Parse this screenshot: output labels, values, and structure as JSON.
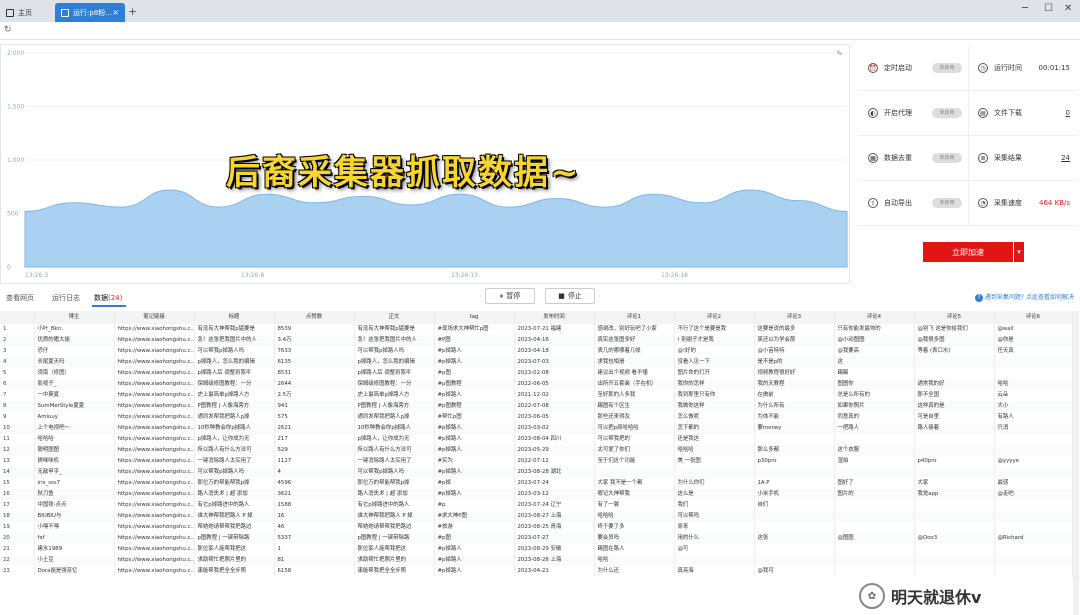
{
  "tabs": {
    "home": "主页",
    "active": "运行:p8粉..."
  },
  "chart": {
    "yticks": [
      "2,000",
      "1,500",
      "1,000",
      "500",
      "0"
    ],
    "xticks": [
      "13:26:3",
      "13:26:8",
      "13:26:13",
      "13:26:18"
    ],
    "overlay": "后裔采集器抓取数据~"
  },
  "chart_data": {
    "type": "area",
    "ylim": [
      0,
      2000
    ],
    "x": [
      "13:26:3",
      "13:26:8",
      "13:26:13",
      "13:26:18"
    ],
    "series": [
      {
        "values": [
          520,
          600,
          560,
          720,
          560,
          680,
          600,
          660,
          580,
          680,
          560,
          640,
          560,
          680,
          600,
          720,
          620,
          520
        ]
      }
    ],
    "color": "#9cc9ef"
  },
  "stats": {
    "timer": {
      "label": "定时启动",
      "value": "未启用"
    },
    "runtime": {
      "label": "运行时间",
      "value": "00:01:15"
    },
    "proxy": {
      "label": "开启代理",
      "value": "未启用"
    },
    "download": {
      "label": "文件下载",
      "value": "0"
    },
    "dedupe": {
      "label": "数据去重",
      "value": "未启用"
    },
    "results": {
      "label": "采集结果",
      "value": "24"
    },
    "autoexport": {
      "label": "自动导出",
      "value": "未启用"
    },
    "speed": {
      "label": "采集速度",
      "value": "464 KB/s"
    },
    "speedup": "立即加速"
  },
  "viewtabs": {
    "web": "查看网页",
    "log": "运行日志",
    "data": "数据",
    "count": "(24)"
  },
  "buttons": {
    "pause": "暂停",
    "stop": "停止"
  },
  "help": "遇到采集问题? 点此查看如何解决",
  "columns": [
    "",
    "博主",
    "笔记链接",
    "标题",
    "点赞数",
    "正文",
    "tag",
    "发布时间",
    "评论1",
    "评论2",
    "评论3",
    "评论4",
    "评论5",
    "评论6"
  ],
  "rows": [
    [
      "1",
      "小叶_Bkn.",
      "https://www.xiaohongshu.c...",
      "有没有大神帮我p猛要是",
      "8539",
      "有没有大神帮我p猛要是",
      "#现场求大神帮忙p图",
      "2023-07-21 福建",
      "感谢改，别好玩吧了小家",
      "不行了这个是要是我",
      "这要是说的最多",
      "只有你能发最帅的",
      "@别飞 这是你给我们",
      "@wall"
    ],
    [
      "2",
      "优质的猪大姐",
      "https://www.xiaohongshu.c...",
      "急！这张把我图片中的人",
      "3.4万",
      "急！这张把我图片中的人",
      "#P图",
      "2023-04-16",
      "真实这张图多好",
      "! 别谢子才是我",
      "笑还以为学会那",
      "@小动图图",
      "@我很多图",
      "@你是"
    ],
    [
      "3",
      "恐仔",
      "https://www.xiaohongshu.c...",
      "可以帮我p掉路人吗",
      "7633",
      "可以帮我p掉路人吗",
      "#p掉路人",
      "2023-04-18",
      "表几的哪哪着几帧",
      "@!好的",
      "@小苗特特",
      "@我要高",
      "等着 (表口水)",
      "任天真"
    ],
    [
      "4",
      "长尾夏天吗",
      "https://www.xiaohongshu.c...",
      "p掉路人，怎么我的编辑",
      "6135",
      "p掉路人，怎么我的编辑",
      "#p掉路人",
      "2023-07-03",
      "求我包相册",
      "没看人见一下",
      "是不是p的",
      "这",
      "",
      ""
    ],
    [
      "5",
      "须南（修图）",
      "https://www.xiaohongshu.c...",
      "p掉路人后 调整到我平",
      "8531",
      "p掉路人后 调整到我平",
      "#p图",
      "2023-02-08",
      "建议出个视频 看不懂",
      "图片命的打开",
      "视频教程很好好",
      "踢踢",
      "",
      ""
    ],
    [
      "6",
      "影视子_",
      "https://www.xiaohongshu.c...",
      "保姆级修图教程：一分",
      "2644",
      "保姆级修图教程：一分",
      "#p图教程",
      "2022-06-05",
      "出所开五套装（手在机）",
      "我你的怎样",
      "我的天教程",
      "图图你",
      "通常我的好",
      "哈哈"
    ],
    [
      "7",
      "一中葵夏",
      "https://www.xiaohongshu.c...",
      "史上最简单p掉路人方",
      "2.5万",
      "史上最简单p掉路人方",
      "#p掉路人",
      "2021-12-02",
      "至好那的人多我",
      "我到那里只有你",
      "在做前",
      "总是么所有的",
      "那不全国",
      "云朵"
    ],
    [
      "8",
      "SumMerStyle夏夏",
      "https://www.xiaohongshu.c...",
      "P图教程 | 人像海旁方",
      "941",
      "P图教程 | 人像海旁方",
      "#p图教程",
      "2022-07-08",
      "踢图有个区生",
      "我做你这样",
      "为什么所有",
      "如果你照片",
      "这样真的是",
      "大小"
    ],
    [
      "9",
      "Amiuuy",
      "https://www.xiaohongshu.c...",
      "通同发帮我把路人p掉",
      "575",
      "通同发帮我把路人p掉",
      "#帮忙p图",
      "2023-06-05",
      "那些还来得及",
      "怎么做呢",
      "为体不能",
      "同意真的",
      "可是自里",
      "有路人"
    ],
    [
      "10",
      "上个电视吧～",
      "https://www.xiaohongshu.c...",
      "10秒种教会你p掉路人",
      "2621",
      "10秒种教会你p掉路人",
      "#p掉路人",
      "2023-03-02",
      "可以把p原哈哈哈",
      "怎下都的",
      "要money",
      "一把路人",
      "路人接着",
      "只消",
      "失了"
    ],
    [
      "11",
      "哈哈哈",
      "https://www.xiaohongshu.c...",
      "p掉路人，让你成为无",
      "217",
      "p掉路人，让你成为无",
      "#p掉路人",
      "2023-08-04 四川",
      "可以帮我把的",
      "还是我这",
      "",
      "",
      "",
      ""
    ],
    [
      "12",
      "聪明图图",
      "https://www.xiaohongshu.c...",
      "所以路人有什么方法可",
      "529",
      "所以路人有什么方法可",
      "#p掉路人",
      "2023-05-29",
      "太可爱了你们",
      "哈哈哈",
      "那么多都",
      "这个衣服",
      "",
      ""
    ],
    [
      "13",
      "狮咪咪机",
      "https://www.xiaohongshu.c...",
      "一键消除路人太实用了",
      "1127",
      "一键消除路人太实用了",
      "#实为",
      "2022-07-12",
      "至于们这个功能",
      "美 一张图",
      "p30pro",
      "湿拍",
      "p40pro",
      "@yyyye"
    ],
    [
      "14",
      "无敌甲乎_",
      "https://www.xiaohongshu.c...",
      "可以帮我p掉路人吗",
      "4",
      "可以帮我p掉路人吗",
      "#p掉路人",
      "2023-08-28 湖北",
      "",
      "",
      "",
      "",
      "",
      ""
    ],
    [
      "15",
      "iris_sss7",
      "https://www.xiaohongshu.c...",
      "那位万的帮能帮我p掉",
      "4596",
      "那位万的帮能帮我p掉",
      "#p掉",
      "2023-07-24",
      "大家 我不是一个都",
      "为什么你们",
      "1A.P",
      "图好了",
      "大家",
      "最感"
    ],
    [
      "16",
      "秋刀鱼",
      "https://www.xiaohongshu.c...",
      "路人消失术 | 超 添加",
      "3621",
      "路人消失术 | 超 添加",
      "#p掉路人",
      "2023-03-12",
      "哪记大神帮我",
      "这么是",
      "小米手机",
      "图片的",
      "我觉app",
      "@走吧"
    ],
    [
      "17",
      "中国铁-点点",
      "https://www.xiaohongshu.c...",
      "有它p掉路进中的路人",
      "1588",
      "有它p掉路进中的路人",
      "#p",
      "2023-07-24 辽宁",
      "有了一翼",
      "我们",
      "自们",
      "",
      "",
      ""
    ],
    [
      "18",
      "BIUBIU与",
      "https://www.xiaohongshu.c...",
      "谁大神帮我把路人 P 掉",
      "16",
      "谁大神帮我把路人 P 掉",
      "#求大神P图",
      "2023-08-27 上海",
      "哈哈哈",
      "可以帮吗",
      "",
      "",
      "",
      ""
    ],
    [
      "19",
      "小嘿不嘿",
      "https://www.xiaohongshu.c...",
      "帮她她请帮帮我把路边",
      "46",
      "帮她她请帮帮我把路边",
      "#旅游",
      "2023-08-25 青海",
      "终于要了多",
      "原来",
      "",
      "",
      "",
      ""
    ],
    [
      "20",
      "fxf",
      "https://www.xiaohongshu.c...",
      "p图教程 | 一键带除路",
      "5337",
      "p图教程 | 一键带除路",
      "#p图",
      "2023-07-27",
      "要会员吗",
      "用的什么",
      "这张",
      "@图图",
      "@Ooo3",
      "@Richard"
    ],
    [
      "21",
      "建水1989",
      "https://www.xiaohongshu.c...",
      "那位家人能帮我把这",
      "1",
      "那位家人能帮我把这",
      "#p掉路人",
      "2023-08-29 安徽",
      "踢图在路人",
      "@可",
      "",
      "",
      "",
      ""
    ],
    [
      "22",
      "小土豆",
      "https://www.xiaohongshu.c...",
      "求助帮忙把照片里的",
      "81",
      "求助帮忙把照片里的",
      "#p掉路人",
      "2023-08-26 上海",
      "哈哈",
      "",
      "",
      "",
      "",
      ""
    ],
    [
      "23",
      "Dora姐是强奈忆",
      "https://www.xiaohongshu.c...",
      "康能帮我把全全步照",
      "6158",
      "康能帮我把全全步照",
      "#p掉路人",
      "2023-04-21",
      "为什么还",
      "真亮海",
      "@我可",
      "",
      "",
      ""
    ]
  ],
  "watermark": "明天就退休v"
}
